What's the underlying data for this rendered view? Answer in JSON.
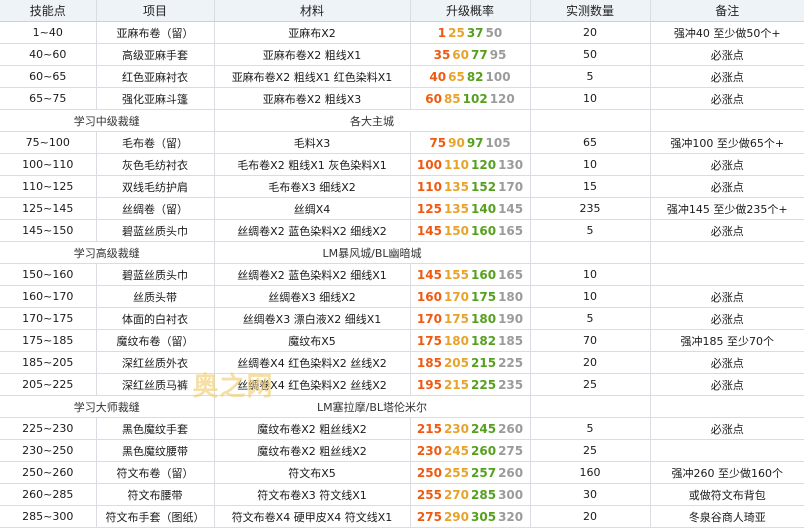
{
  "headers": [
    "技能点",
    "项目",
    "材料",
    "升级概率",
    "实测数量",
    "备注"
  ],
  "colors": {
    "p1": "#ee5a12",
    "p2": "#e7a32a",
    "p3": "#56a01f",
    "p4": "#9b9b9b"
  },
  "watermark": "奥之网",
  "rows": [
    {
      "type": "data",
      "skill": "1~40",
      "item": "亚麻布卷（留）",
      "materials": "亚麻布X2",
      "prob": [
        "1",
        "25",
        "37",
        "50"
      ],
      "count": "20",
      "note": "强冲40 至少做50个+"
    },
    {
      "type": "data",
      "skill": "40~60",
      "item": "高级亚麻手套",
      "materials": "亚麻布卷X2 粗线X1",
      "prob": [
        "35",
        "60",
        "77",
        "95"
      ],
      "count": "50",
      "note": "必涨点"
    },
    {
      "type": "data",
      "skill": "60~65",
      "item": "红色亚麻衬衣",
      "materials": "亚麻布卷X2 粗线X1 红色染料X1",
      "prob": [
        "40",
        "65",
        "82",
        "100"
      ],
      "count": "5",
      "note": "必涨点"
    },
    {
      "type": "data",
      "skill": "65~75",
      "item": "强化亚麻斗篷",
      "materials": "亚麻布卷X2 粗线X3",
      "prob": [
        "60",
        "85",
        "102",
        "120"
      ],
      "count": "10",
      "note": "必涨点"
    },
    {
      "type": "section",
      "skill": "学习中级裁缝",
      "materials": "各大主城"
    },
    {
      "type": "data",
      "skill": "75~100",
      "item": "毛布卷（留）",
      "materials": "毛料X3",
      "prob": [
        "75",
        "90",
        "97",
        "105"
      ],
      "count": "65",
      "note": "强冲100 至少做65个+"
    },
    {
      "type": "data",
      "skill": "100~110",
      "item": "灰色毛纺衬衣",
      "materials": "毛布卷X2 粗线X1 灰色染料X1",
      "prob": [
        "100",
        "110",
        "120",
        "130"
      ],
      "count": "10",
      "note": "必涨点"
    },
    {
      "type": "data",
      "skill": "110~125",
      "item": "双线毛纺护肩",
      "materials": "毛布卷X3 细线X2",
      "prob": [
        "110",
        "135",
        "152",
        "170"
      ],
      "count": "15",
      "note": "必涨点"
    },
    {
      "type": "data",
      "skill": "125~145",
      "item": "丝绸卷（留）",
      "materials": "丝绸X4",
      "prob": [
        "125",
        "135",
        "140",
        "145"
      ],
      "count": "235",
      "note": "强冲145 至少做235个+"
    },
    {
      "type": "data",
      "skill": "145~150",
      "item": "碧蓝丝质头巾",
      "materials": "丝绸卷X2 蓝色染料X2 细线X2",
      "prob": [
        "145",
        "150",
        "160",
        "165"
      ],
      "count": "5",
      "note": "必涨点"
    },
    {
      "type": "section",
      "skill": "学习高级裁缝",
      "materials": "LM暴风城/BL幽暗城"
    },
    {
      "type": "data",
      "skill": "150~160",
      "item": "碧蓝丝质头巾",
      "materials": "丝绸卷X2 蓝色染料X2 细线X1",
      "prob": [
        "145",
        "155",
        "160",
        "165"
      ],
      "count": "10",
      "note": ""
    },
    {
      "type": "data",
      "skill": "160~170",
      "item": "丝质头带",
      "materials": "丝绸卷X3 细线X2",
      "prob": [
        "160",
        "170",
        "175",
        "180"
      ],
      "count": "10",
      "note": "必涨点"
    },
    {
      "type": "data",
      "skill": "170~175",
      "item": "体面的白衬衣",
      "materials": "丝绸卷X3 漂白液X2 细线X1",
      "prob": [
        "170",
        "175",
        "180",
        "190"
      ],
      "count": "5",
      "note": "必涨点"
    },
    {
      "type": "data",
      "skill": "175~185",
      "item": "魔纹布卷（留）",
      "materials": "魔纹布X5",
      "prob": [
        "175",
        "180",
        "182",
        "185"
      ],
      "count": "70",
      "note": "强冲185 至少70个"
    },
    {
      "type": "data",
      "skill": "185~205",
      "item": "深红丝质外衣",
      "materials": "丝绸卷X4 红色染料X2 丝线X2",
      "prob": [
        "185",
        "205",
        "215",
        "225"
      ],
      "count": "20",
      "note": "必涨点"
    },
    {
      "type": "data",
      "skill": "205~225",
      "item": "深红丝质马裤",
      "materials": "丝绸卷X4 红色染料X2 丝线X2",
      "prob": [
        "195",
        "215",
        "225",
        "235"
      ],
      "count": "25",
      "note": "必涨点"
    },
    {
      "type": "section",
      "skill": "学习大师裁缝",
      "materials": "LM塞拉摩/BL塔伦米尔"
    },
    {
      "type": "data",
      "skill": "225~230",
      "item": "黑色魔纹手套",
      "materials": "魔纹布卷X2 粗丝线X2",
      "prob": [
        "215",
        "230",
        "245",
        "260"
      ],
      "count": "5",
      "note": "必涨点"
    },
    {
      "type": "data",
      "skill": "230~250",
      "item": "黑色魔纹腰带",
      "materials": "魔纹布卷X2 粗丝线X2",
      "prob": [
        "230",
        "245",
        "260",
        "275"
      ],
      "count": "25",
      "note": ""
    },
    {
      "type": "data",
      "skill": "250~260",
      "item": "符文布卷（留）",
      "materials": "符文布X5",
      "prob": [
        "250",
        "255",
        "257",
        "260"
      ],
      "count": "160",
      "note": "强冲260 至少做160个"
    },
    {
      "type": "data",
      "skill": "260~285",
      "item": "符文布腰带",
      "materials": "符文布卷X3 符文线X1",
      "prob": [
        "255",
        "270",
        "285",
        "300"
      ],
      "count": "30",
      "note": "或做符文布背包"
    },
    {
      "type": "data",
      "skill": "285~300",
      "item": "符文布手套（图纸）",
      "materials": "符文布卷X4 硬甲皮X4 符文线X1",
      "prob": [
        "275",
        "290",
        "305",
        "320"
      ],
      "count": "20",
      "note": "冬泉谷商人琦亚"
    }
  ]
}
